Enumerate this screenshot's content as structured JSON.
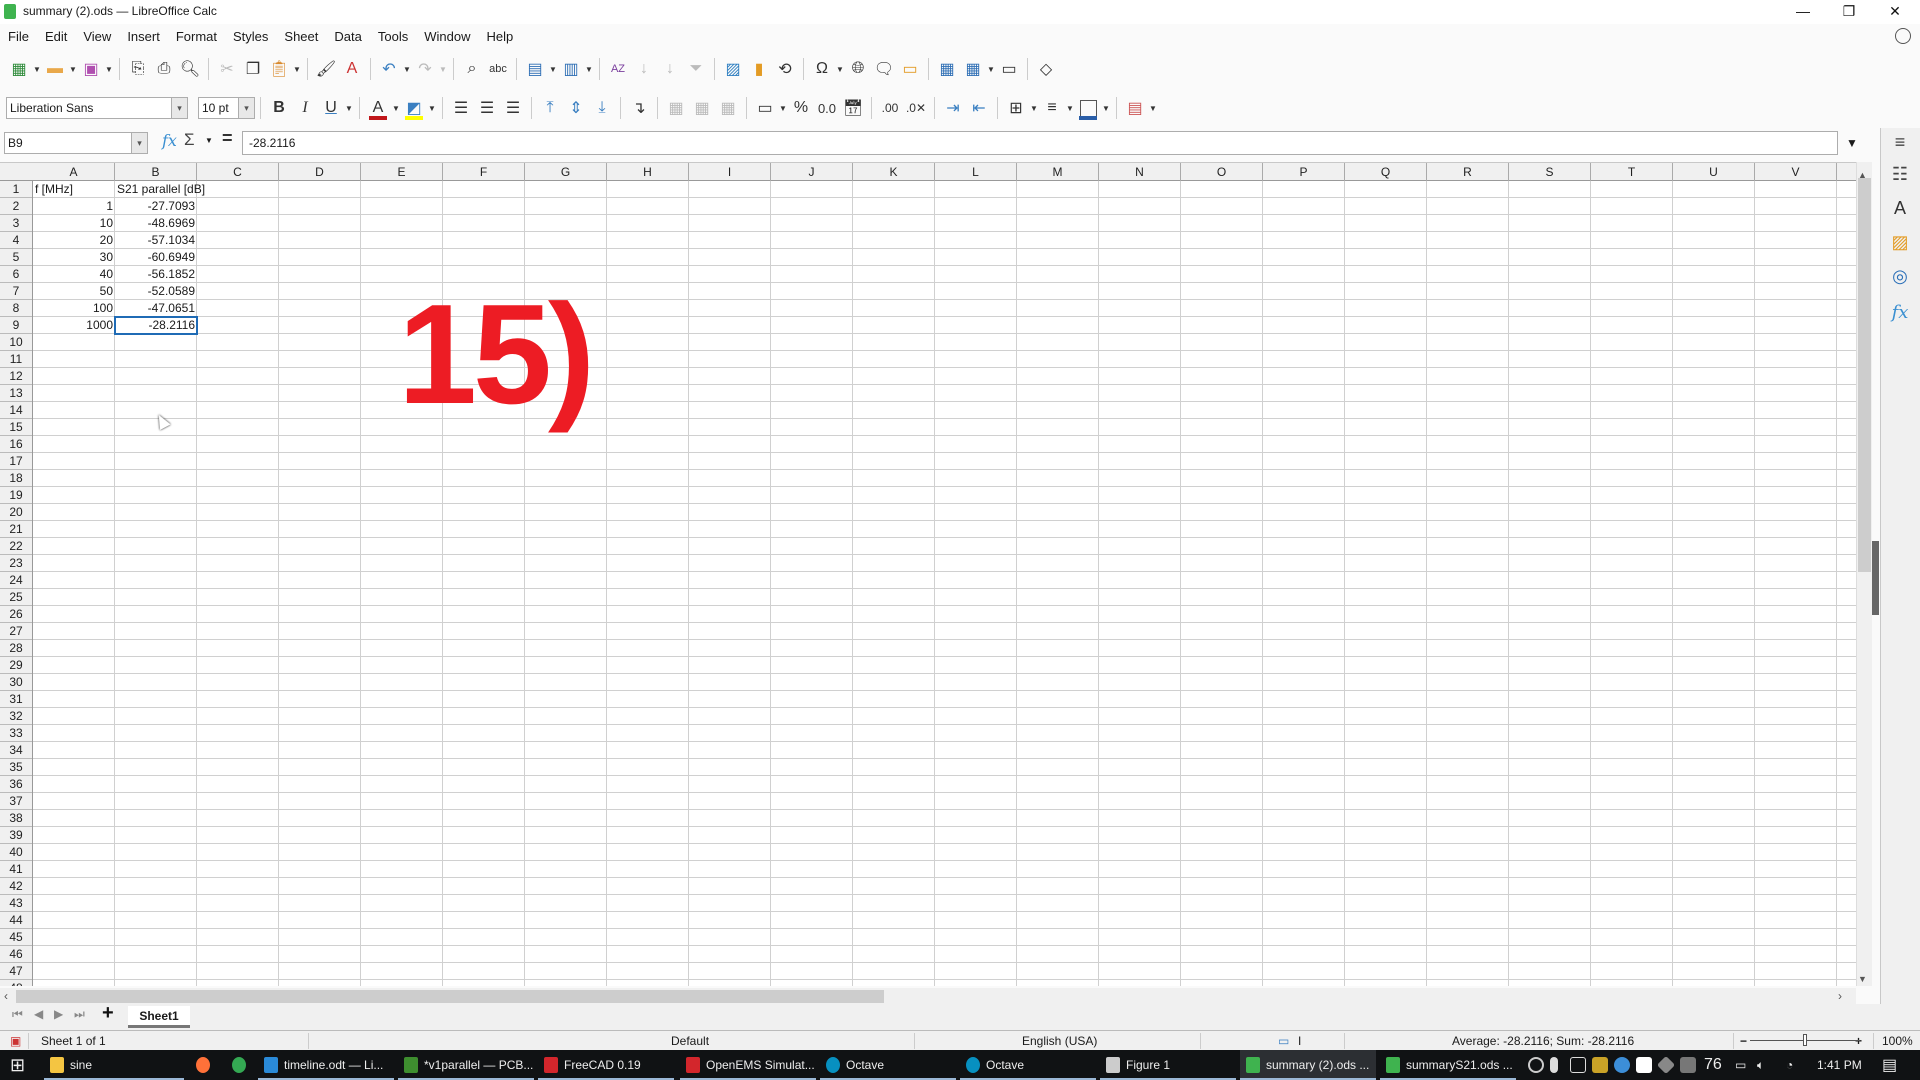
{
  "window": {
    "title": "summary (2).ods — LibreOffice Calc",
    "controls": {
      "minimize": "—",
      "maximize": "❐",
      "close": "✕"
    }
  },
  "menu": [
    "File",
    "Edit",
    "View",
    "Insert",
    "Format",
    "Styles",
    "Sheet",
    "Data",
    "Tools",
    "Window",
    "Help"
  ],
  "toolbar2": {
    "font_name": "Liberation Sans",
    "font_size": "10 pt",
    "bold": "B",
    "italic": "I",
    "underline": "U",
    "percent": "%",
    "number": "0.0",
    "font_color": "#c0161a",
    "highlight_color": "#ffff00"
  },
  "formula_bar": {
    "name_box": "B9",
    "fx": "fx",
    "sum": "Σ",
    "equals": "=",
    "content": "-28.2116"
  },
  "columns": [
    "A",
    "B",
    "C",
    "D",
    "E",
    "F",
    "G",
    "H",
    "I",
    "J",
    "K",
    "L",
    "M",
    "N",
    "O",
    "P",
    "Q",
    "R",
    "S",
    "T",
    "U",
    "V"
  ],
  "rows_visible": 47,
  "sheet": {
    "header": [
      "f [MHz]",
      "S21 parallel [dB]"
    ],
    "data": [
      [
        "1",
        "-27.7093"
      ],
      [
        "10",
        "-48.6969"
      ],
      [
        "20",
        "-57.1034"
      ],
      [
        "30",
        "-60.6949"
      ],
      [
        "40",
        "-56.1852"
      ],
      [
        "50",
        "-52.0589"
      ],
      [
        "100",
        "-47.0651"
      ],
      [
        "1000",
        "-28.2116"
      ]
    ],
    "selected_cell": "B9"
  },
  "overlay_label": {
    "text": "15)",
    "color": "#ed1c24"
  },
  "sheet_tabs": {
    "tabs": [
      "Sheet1"
    ],
    "active": "Sheet1",
    "add": "+"
  },
  "status": {
    "sheet_info": "Sheet 1 of 1",
    "page_style": "Default",
    "language": "English (USA)",
    "selection_summary": "Average: -28.2116; Sum: -28.2116",
    "zoom_out": "−",
    "zoom_in": "+",
    "zoom": "100%",
    "zoom_fraction": 0.5
  },
  "taskbar": {
    "items": [
      {
        "label": "sine",
        "icon": "folder-icon",
        "color": "#f4c542"
      },
      {
        "label": "",
        "icon": "firefox-icon",
        "color": "#ff7139"
      },
      {
        "label": "",
        "icon": "chrome-icon",
        "color": "#34a853"
      },
      {
        "label": "timeline.odt — Li...",
        "icon": "writer-icon",
        "color": "#2a8ad8"
      },
      {
        "label": "*v1parallel — PCB...",
        "icon": "kicad-pcb-icon",
        "color": "#3e8e2f"
      },
      {
        "label": "FreeCAD 0.19",
        "icon": "freecad-icon",
        "color": "#d3262c"
      },
      {
        "label": "OpenEMS Simulat...",
        "icon": "freecad-icon",
        "color": "#d3262c"
      },
      {
        "label": "Octave",
        "icon": "octave-icon",
        "color": "#0790c0"
      },
      {
        "label": "Octave",
        "icon": "octave-icon",
        "color": "#0790c0"
      },
      {
        "label": "Figure 1",
        "icon": "figure-icon",
        "color": "#cccccc"
      },
      {
        "label": "summary (2).ods ...",
        "icon": "calc-icon",
        "color": "#3fb34f"
      },
      {
        "label": "summaryS21.ods ...",
        "icon": "calc-icon",
        "color": "#3fb34f"
      }
    ],
    "tray_number": "76",
    "time": "1:41 PM"
  }
}
